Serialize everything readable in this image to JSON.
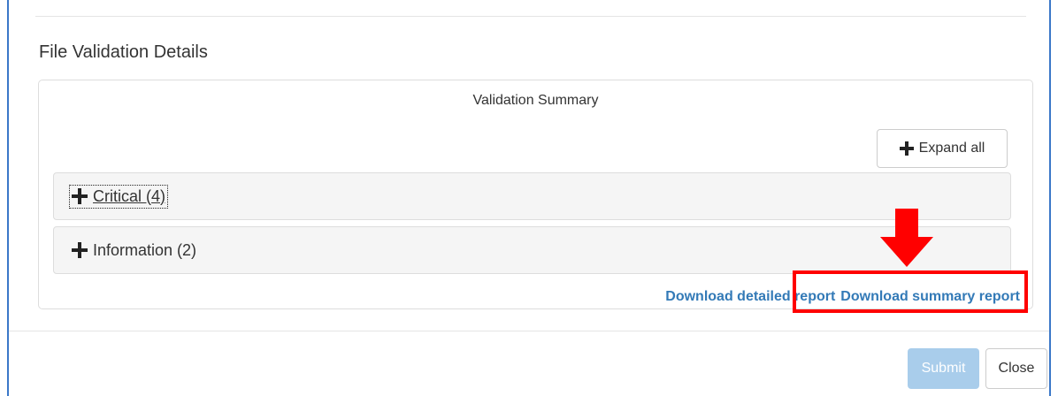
{
  "dialog": {
    "section_title": "File Validation Details",
    "summary_title": "Validation Summary",
    "expand_all_label": "Expand all",
    "groups": [
      {
        "label": "Critical (4)"
      },
      {
        "label": "Information (2)"
      }
    ],
    "links": {
      "detailed": "Download detailed report",
      "summary": "Download summary report"
    },
    "footer": {
      "submit_label": "Submit",
      "close_label": "Close"
    }
  },
  "colors": {
    "link": "#337ab7",
    "annotation": "#ff0000",
    "submit_disabled": "#a9cdeb",
    "modal_border": "#3b78c8"
  },
  "icons": {
    "expand": "plus-icon",
    "annotation_arrow": "down-arrow-icon"
  }
}
